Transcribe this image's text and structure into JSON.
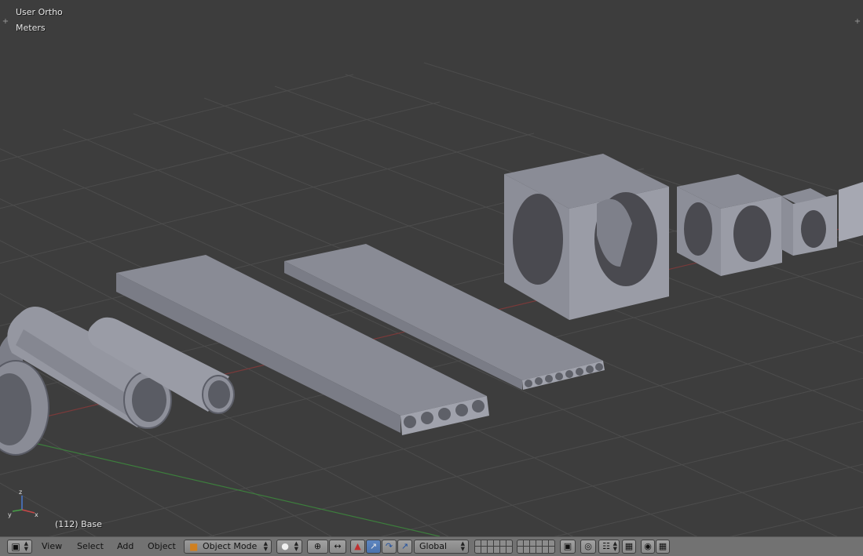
{
  "viewport": {
    "view_name": "User Ortho",
    "units": "Meters",
    "status": "(112) Base"
  },
  "header": {
    "menu": {
      "view": "View",
      "select": "Select",
      "add": "Add",
      "object": "Object"
    },
    "mode": "Object Mode",
    "orientation": "Global"
  },
  "colors": {
    "viewport_bg": "#3d3d3d",
    "grid": "#4a4a4a",
    "x_axis": "#8a3a3a",
    "y_axis": "#3e8a3e",
    "mesh_light": "#9a9ca4",
    "mesh_mid": "#858791",
    "mesh_dark": "#6c6e78",
    "header_bg": "#727272",
    "active_blue": "#4a72ad"
  },
  "icons": [
    "editor-type-cube-icon",
    "object-mode-cube-icon",
    "viewport-shading-icon",
    "pivot-point-icon",
    "manipulator-axes-icon",
    "translate-arrow-icon",
    "rotate-icon",
    "scale-icon",
    "layer-grid-icon",
    "lock-scene-icon",
    "proportional-edit-icon",
    "snap-icon",
    "render-camera-icon",
    "clapper-icon"
  ]
}
